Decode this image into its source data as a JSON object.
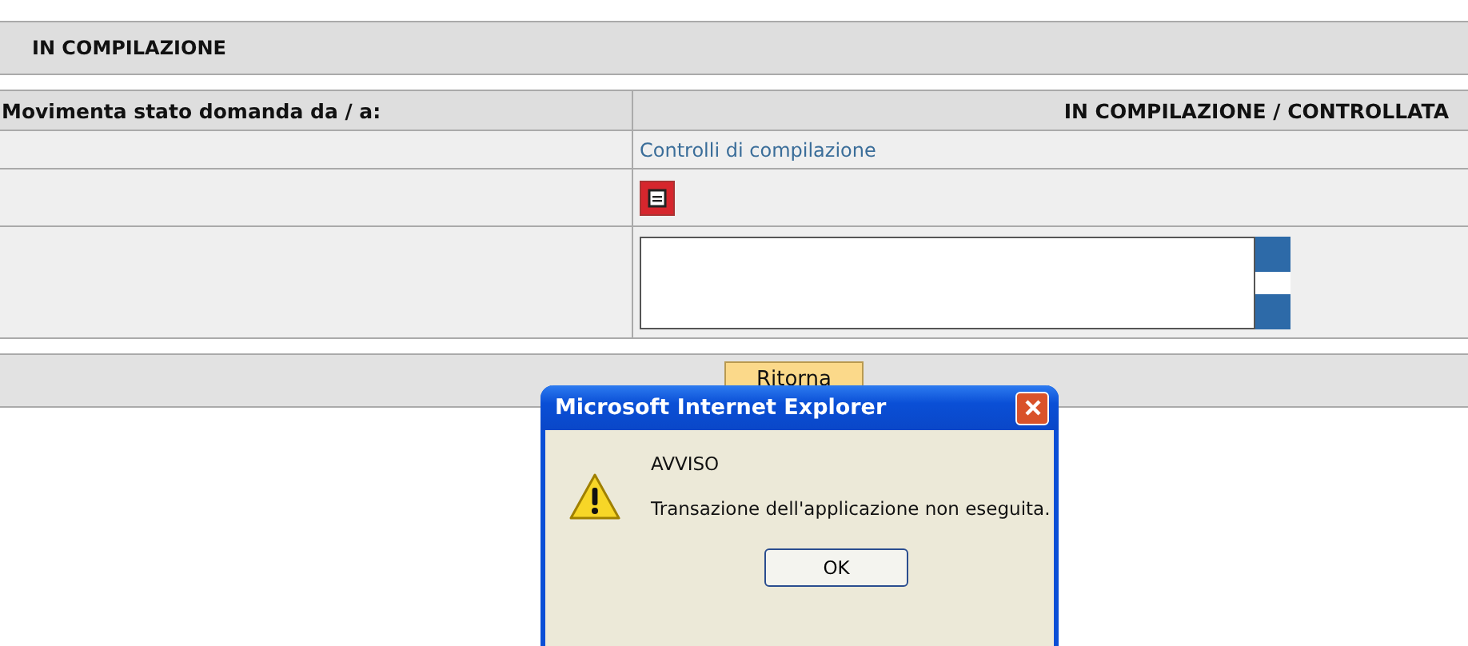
{
  "section_title": "IN COMPILAZIONE",
  "table": {
    "header_left": "Movimenta stato domanda da / a:",
    "header_right": "IN COMPILAZIONE / CONTROLLATA",
    "link": "Controlli di compilazione"
  },
  "footer": {
    "button": "Ritorna"
  },
  "dialog": {
    "title": "Microsoft Internet Explorer",
    "heading": "AVVISO",
    "message": "Transazione dell'applicazione non eseguita.",
    "button": "OK"
  }
}
